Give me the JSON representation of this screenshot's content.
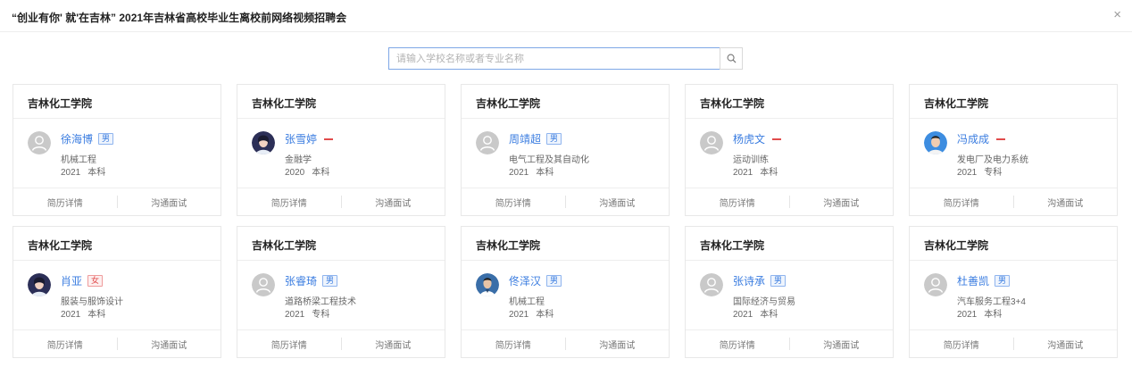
{
  "header": {
    "title": "“创业有你' 就'在吉林” 2021年吉林省高校毕业生离校前网络视频招聘会",
    "close_label": "×"
  },
  "search": {
    "placeholder": "请输入学校名称或者专业名称",
    "value": "",
    "button_icon": "search-icon"
  },
  "cards": [
    {
      "school": "吉林化工学院",
      "name": "徐海博",
      "gender": "男",
      "badge": "male",
      "avatar": "placeholder",
      "major": "机械工程",
      "year": "2021",
      "degree": "本科",
      "btn_resume": "简历详情",
      "btn_interview": "沟通面试"
    },
    {
      "school": "吉林化工学院",
      "name": "张雪婷",
      "gender": "",
      "badge": "dash",
      "avatar": "photo-female",
      "major": "金融学",
      "year": "2020",
      "degree": "本科",
      "btn_resume": "简历详情",
      "btn_interview": "沟通面试"
    },
    {
      "school": "吉林化工学院",
      "name": "周靖超",
      "gender": "男",
      "badge": "male",
      "avatar": "placeholder",
      "major": "电气工程及其自动化",
      "year": "2021",
      "degree": "本科",
      "btn_resume": "简历详情",
      "btn_interview": "沟通面试"
    },
    {
      "school": "吉林化工学院",
      "name": "杨虎文",
      "gender": "",
      "badge": "dash",
      "avatar": "placeholder",
      "major": "运动训练",
      "year": "2021",
      "degree": "本科",
      "btn_resume": "简历详情",
      "btn_interview": "沟通面试"
    },
    {
      "school": "吉林化工学院",
      "name": "冯成成",
      "gender": "",
      "badge": "dash",
      "avatar": "photo-male-blue",
      "major": "发电厂及电力系统",
      "year": "2021",
      "degree": "专科",
      "btn_resume": "简历详情",
      "btn_interview": "沟通面试"
    },
    {
      "school": "吉林化工学院",
      "name": "肖亚",
      "gender": "女",
      "badge": "female",
      "avatar": "photo-female",
      "major": "服装与服饰设计",
      "year": "2021",
      "degree": "本科",
      "btn_resume": "简历详情",
      "btn_interview": "沟通面试"
    },
    {
      "school": "吉林化工学院",
      "name": "张睿琦",
      "gender": "男",
      "badge": "male",
      "avatar": "placeholder",
      "major": "道路桥梁工程技术",
      "year": "2021",
      "degree": "专科",
      "btn_resume": "简历详情",
      "btn_interview": "沟通面试"
    },
    {
      "school": "吉林化工学院",
      "name": "佟泽汉",
      "gender": "男",
      "badge": "male",
      "avatar": "photo-male-dark",
      "major": "机械工程",
      "year": "2021",
      "degree": "本科",
      "btn_resume": "简历详情",
      "btn_interview": "沟通面试"
    },
    {
      "school": "吉林化工学院",
      "name": "张诗承",
      "gender": "男",
      "badge": "male",
      "avatar": "placeholder",
      "major": "国际经济与贸易",
      "year": "2021",
      "degree": "本科",
      "btn_resume": "简历详情",
      "btn_interview": "沟通面试"
    },
    {
      "school": "吉林化工学院",
      "name": "杜善凯",
      "gender": "男",
      "badge": "male",
      "avatar": "placeholder",
      "major": "汽车服务工程3+4",
      "year": "2021",
      "degree": "本科",
      "btn_resume": "简历详情",
      "btn_interview": "沟通面试"
    }
  ],
  "colors": {
    "accent": "#3b7de0",
    "male_badge": "#3b7de0",
    "female_badge": "#e14b4b",
    "border": "#e8e8e8"
  }
}
